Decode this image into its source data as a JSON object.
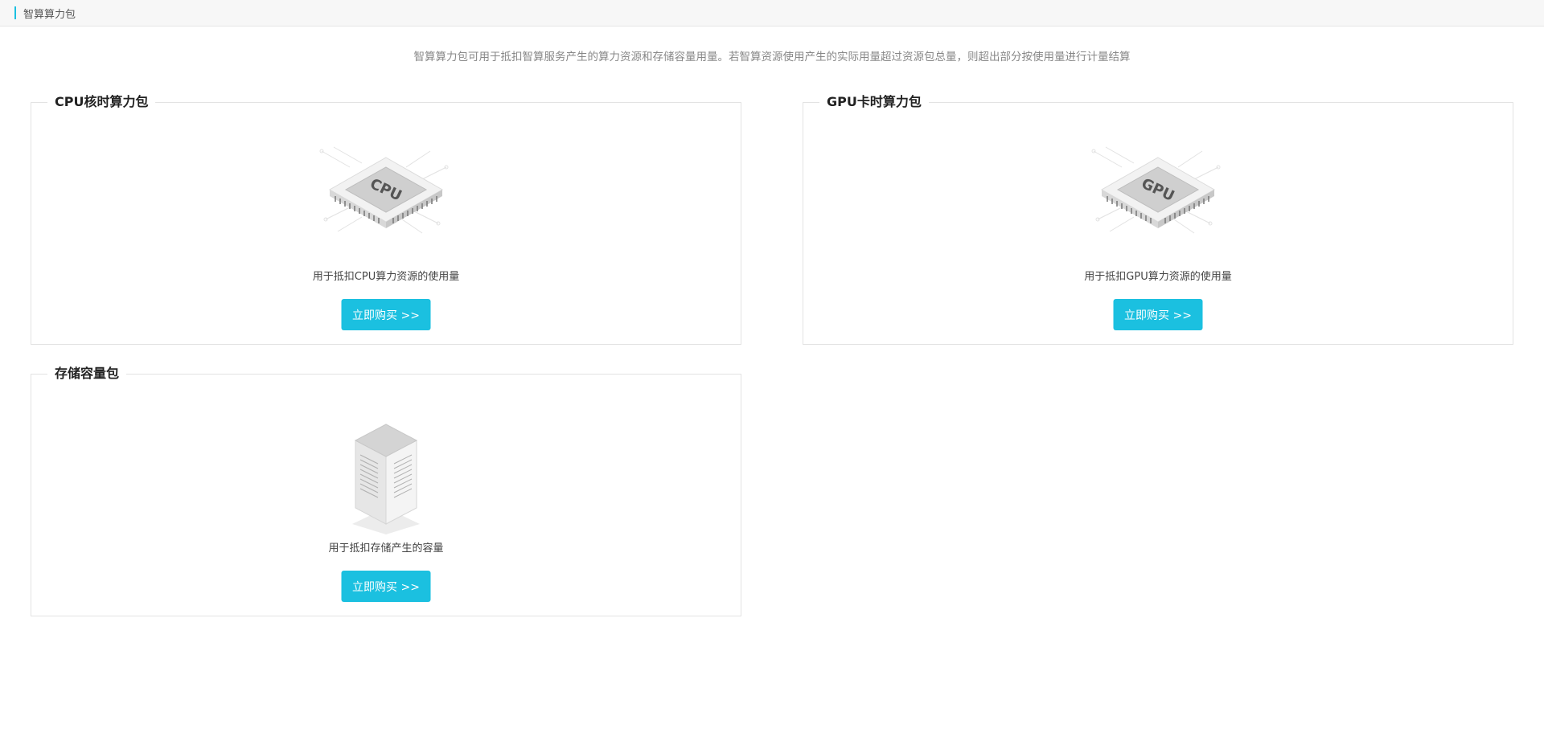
{
  "header": {
    "title": "智算算力包"
  },
  "description": "智算算力包可用于抵扣智算服务产生的算力资源和存储容量用量。若智算资源使用产生的实际用量超过资源包总量，则超出部分按使用量进行计量结算",
  "packs": [
    {
      "title": "CPU核时算力包",
      "chip_label": "CPU",
      "icon": "cpu-chip-icon",
      "caption": "用于抵扣CPU算力资源的使用量",
      "button": "立即购买 >>"
    },
    {
      "title": "GPU卡时算力包",
      "chip_label": "GPU",
      "icon": "gpu-chip-icon",
      "caption": "用于抵扣GPU算力资源的使用量",
      "button": "立即购买 >>"
    },
    {
      "title": "存储容量包",
      "icon": "storage-server-icon",
      "caption": "用于抵扣存储产生的容量",
      "button": "立即购买 >>"
    }
  ],
  "colors": {
    "accent": "#1bc0e0",
    "button_bg": "#1bc0e0",
    "border": "#e3e3e3"
  }
}
